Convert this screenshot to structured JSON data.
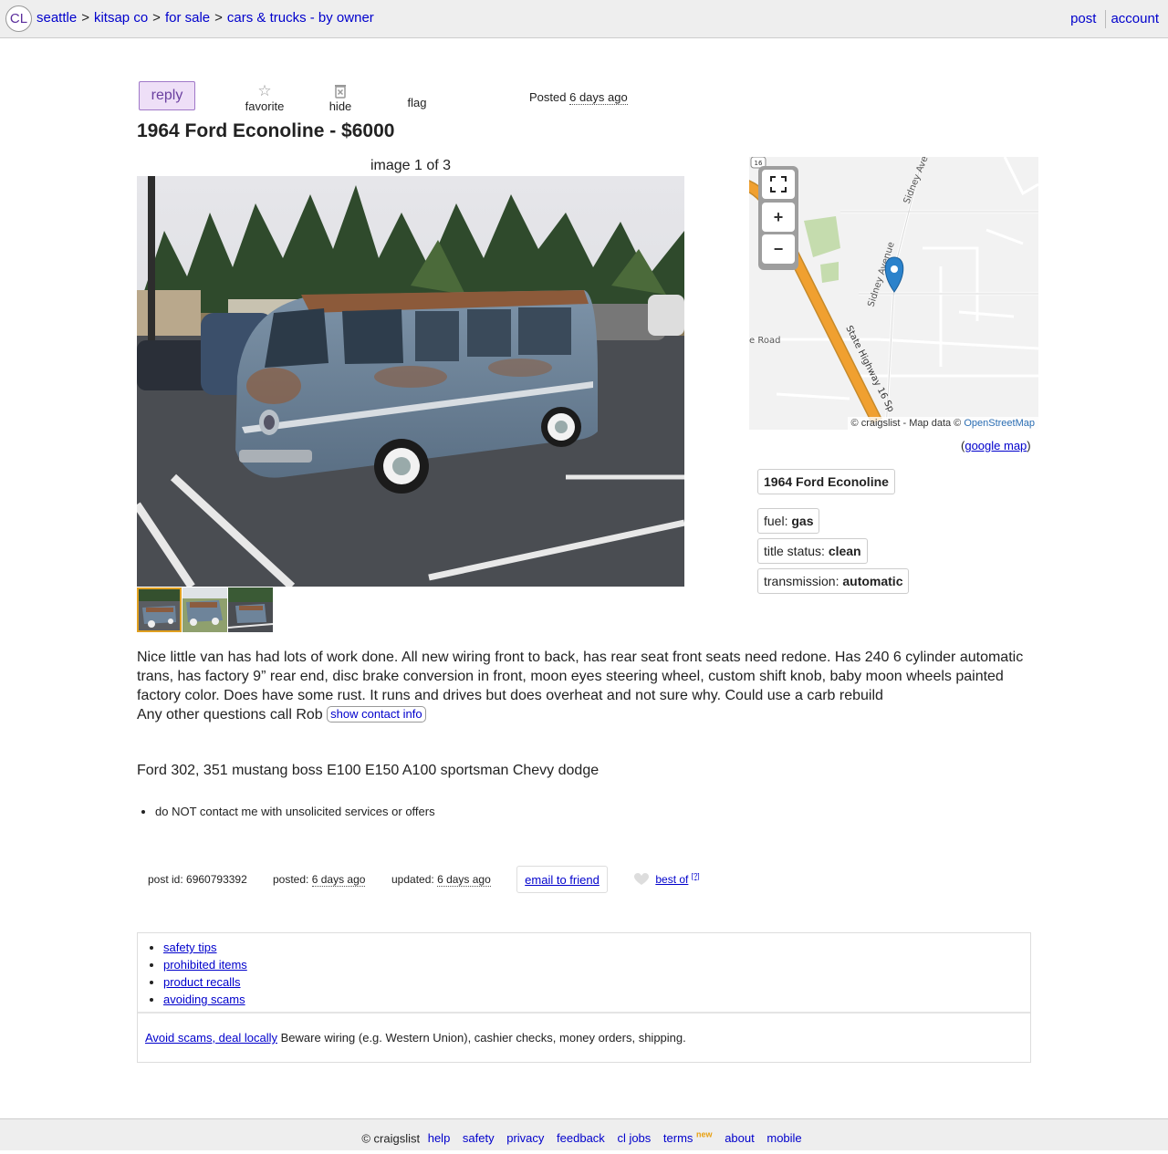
{
  "header": {
    "logo": "CL",
    "breadcrumbs": [
      "seattle",
      "kitsap co",
      "for sale",
      "cars & trucks - by owner"
    ],
    "separator": ">",
    "post_link": "post",
    "account_link": "account"
  },
  "actions": {
    "reply": "reply",
    "favorite": "favorite",
    "hide": "hide",
    "flag": "flag",
    "posted_label": "Posted",
    "posted_value": "6 days ago"
  },
  "listing": {
    "title": "1964 Ford Econoline - $6000",
    "image_counter": "image 1 of 3"
  },
  "map": {
    "labels": {
      "route_16": "16",
      "sidney_ave_top": "Sidney Ave",
      "sidney_ave_mid": "Sidney Avenue",
      "road": "e Road",
      "highway": "State Highway 16 Sp"
    },
    "fullscreen_icon": "fullscreen-icon",
    "zoom_in": "+",
    "zoom_out": "−",
    "attribution_prefix": "© craigslist - Map data ©",
    "attribution_link": "OpenStreetMap",
    "google_map": "google map"
  },
  "attributes": {
    "headline": "1964 Ford Econoline",
    "items": [
      {
        "label": "fuel:",
        "value": "gas"
      },
      {
        "label": "title status:",
        "value": "clean"
      },
      {
        "label": "transmission:",
        "value": "automatic"
      }
    ]
  },
  "body": {
    "paragraph1": "Nice little van has had lots of work done. All new wiring front to back, has rear seat front seats need redone. Has 240 6 cylinder automatic trans, has factory 9” rear end, disc brake conversion in front, moon eyes steering wheel, custom shift knob, baby moon wheels painted factory color. Does have some rust. It runs and drives but does overheat and not sure why. Could use a carb rebuild",
    "paragraph2": "Any other questions call Rob",
    "show_contact": "show contact info",
    "keywords": "Ford 302, 351 mustang boss E100 E150 A100 sportsman Chevy dodge",
    "notice": "do NOT contact me with unsolicited services or offers"
  },
  "postinfo": {
    "post_id": "post id: 6960793392",
    "posted_label": "posted:",
    "posted_value": "6 days ago",
    "updated_label": "updated:",
    "updated_value": "6 days ago",
    "email_friend": "email to friend",
    "best_of": "best of",
    "best_of_help": "[?]"
  },
  "safety": {
    "links": [
      "safety tips",
      "prohibited items",
      "product recalls",
      "avoiding scams"
    ],
    "scam_link": "Avoid scams, deal locally",
    "scam_text": "Beware wiring (e.g. Western Union), cashier checks, money orders, shipping."
  },
  "footer": {
    "copyright": "© craigslist",
    "links": [
      "help",
      "safety",
      "privacy",
      "feedback",
      "cl jobs",
      "terms",
      "about",
      "mobile"
    ],
    "new_tag": "new"
  },
  "colors": {
    "link": "#0000cc",
    "reply_bg": "#eedff7",
    "reply_border": "#a078c8",
    "highway": "#f0a030",
    "map_pin": "#2b82cb",
    "thumb_selected": "#e0a020"
  }
}
